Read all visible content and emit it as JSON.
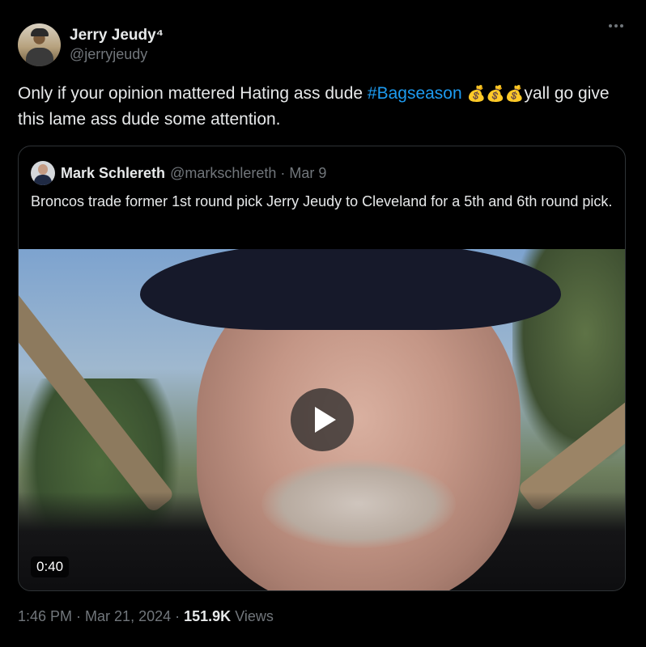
{
  "author": {
    "display_name": "Jerry Jeudy⁴",
    "handle": "@jerryjeudy"
  },
  "tweet": {
    "text_before": "Only if your opinion mattered Hating ass dude ",
    "hashtag": "#Bagseason",
    "emojis": "💰💰💰",
    "text_after": "yall go give this lame ass dude some attention."
  },
  "quoted_tweet": {
    "display_name": "Mark Schlereth",
    "handle": "@markschlereth",
    "separator": "·",
    "date": "Mar 9",
    "text": "Broncos trade former 1st  round pick Jerry Jeudy to Cleveland for a 5th and 6th round pick.",
    "video_duration": "0:40"
  },
  "meta": {
    "time": "1:46 PM",
    "sep1": "·",
    "date": "Mar 21, 2024",
    "sep2": "·",
    "views_count": "151.9K",
    "views_label": "Views"
  },
  "colors": {
    "background": "#000000",
    "text": "#e7e9ea",
    "secondary": "#71767b",
    "link": "#1d9bf0",
    "border": "#2f3336"
  },
  "icons": {
    "more": "more-horizontal-icon",
    "play": "play-icon"
  }
}
